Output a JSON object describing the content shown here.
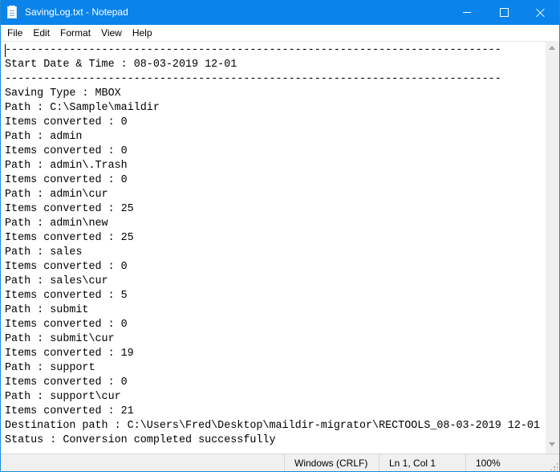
{
  "window": {
    "title": "SavingLog.txt - Notepad"
  },
  "menu": [
    "File",
    "Edit",
    "Format",
    "View",
    "Help"
  ],
  "document": {
    "lines": [
      "-----------------------------------------------------------------------------",
      "Start Date & Time : 08-03-2019 12-01",
      "-----------------------------------------------------------------------------",
      "Saving Type : MBOX",
      "Path : C:\\Sample\\maildir",
      "Items converted : 0",
      "Path : admin",
      "Items converted : 0",
      "Path : admin\\.Trash",
      "Items converted : 0",
      "Path : admin\\cur",
      "Items converted : 25",
      "Path : admin\\new",
      "Items converted : 25",
      "Path : sales",
      "Items converted : 0",
      "Path : sales\\cur",
      "Items converted : 5",
      "Path : submit",
      "Items converted : 0",
      "Path : submit\\cur",
      "Items converted : 19",
      "Path : support",
      "Items converted : 0",
      "Path : support\\cur",
      "Items converted : 21",
      "Destination path : C:\\Users\\Fred\\Desktop\\maildir-migrator\\RECTOOLS_08-03-2019 12-01",
      "Status : Conversion completed successfully"
    ]
  },
  "statusbar": {
    "encoding": "Windows (CRLF)",
    "position": "Ln 1, Col 1",
    "zoom": "100%"
  },
  "colors": {
    "titlebar": "#0a84ea",
    "border": "#1e8bd8"
  },
  "icons": {
    "app": "notepad-icon",
    "minimize": "minimize-icon",
    "maximize": "maximize-icon",
    "close": "close-icon"
  }
}
